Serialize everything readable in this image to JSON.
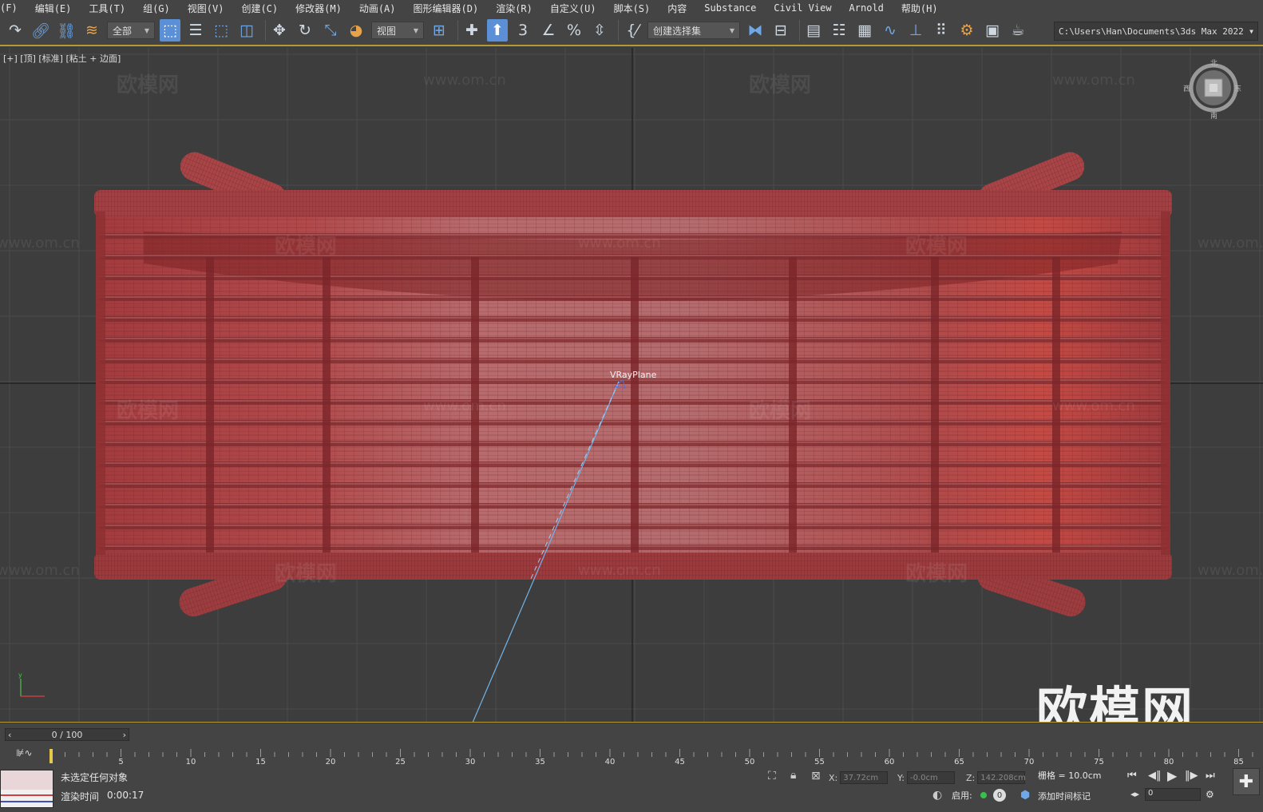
{
  "menu": [
    "(F)",
    "编辑(E)",
    "工具(T)",
    "组(G)",
    "视图(V)",
    "创建(C)",
    "修改器(M)",
    "动画(A)",
    "图形编辑器(D)",
    "渲染(R)",
    "自定义(U)",
    "脚本(S)",
    "内容",
    "Substance",
    "Civil View",
    "Arnold",
    "帮助(H)"
  ],
  "toolbar": {
    "filter_dropdown": "全部",
    "refcoord_dropdown": "视图",
    "selection_set_dropdown": "创建选择集",
    "spinner_snap_label": "3",
    "project_path": "C:\\Users\\Han\\Documents\\3ds Max 2022"
  },
  "viewport": {
    "label": "[+] [顶] [标准] [粘土 + 边面]",
    "object_label": "VRayPlane",
    "watermark_cn": "欧模网",
    "watermark_url": "www.om.cn",
    "watermark_big": "欧模网",
    "viewcube": {
      "north": "北",
      "south": "南",
      "east": "东",
      "west": "西"
    },
    "colors": {
      "object": "#a7464a",
      "background": "#3d3d3d",
      "grid": "#4a4a4a"
    }
  },
  "timeline": {
    "frame_display": "0 / 100",
    "ticks": [
      "5",
      "10",
      "15",
      "20",
      "25",
      "30",
      "35",
      "40",
      "45",
      "50",
      "55",
      "60",
      "65",
      "70",
      "75",
      "80",
      "85"
    ]
  },
  "status": {
    "selection": "未选定任何对象",
    "render_time_label": "渲染时间",
    "render_time": "0:00:17",
    "x_label": "X:",
    "x_value": "37.72cm",
    "y_label": "Y:",
    "y_value": "-0.0cm",
    "z_label": "Z:",
    "z_value": "142.208cm",
    "grid": "栅格 = 10.0cm",
    "enable_label": "启用:",
    "enable_value": "0",
    "add_time_tag": "添加时间标记",
    "frame_value": "0"
  }
}
